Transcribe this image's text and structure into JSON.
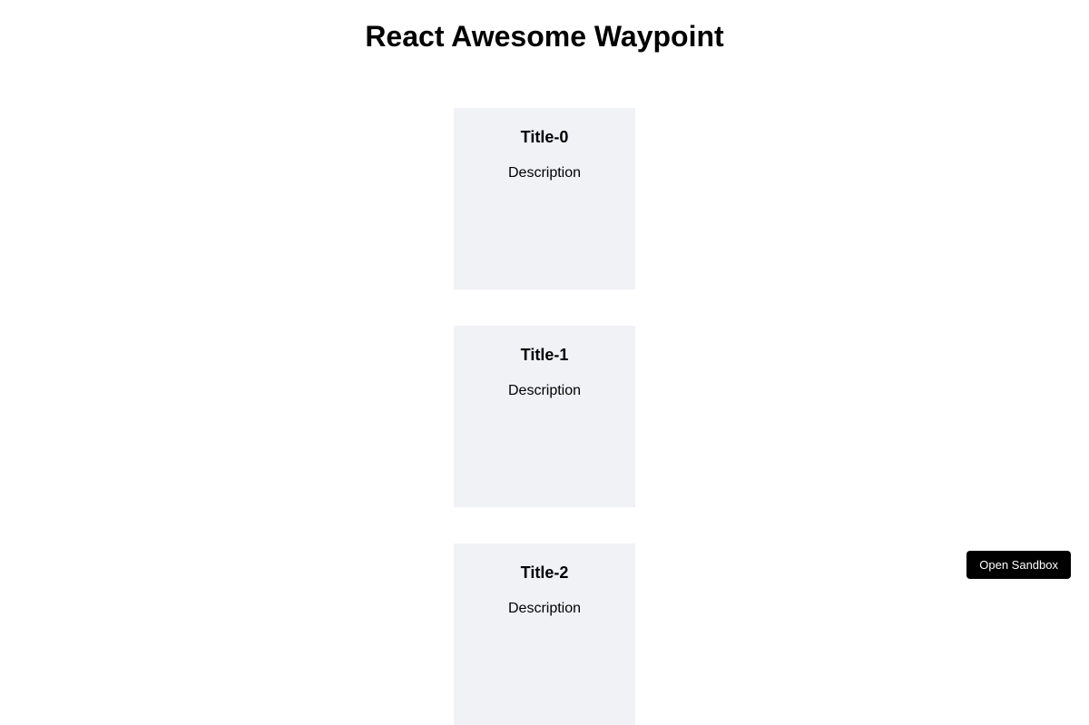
{
  "header": {
    "title": "React Awesome Waypoint"
  },
  "cards": [
    {
      "title": "Title-0",
      "description": "Description"
    },
    {
      "title": "Title-1",
      "description": "Description"
    },
    {
      "title": "Title-2",
      "description": "Description"
    }
  ],
  "footer": {
    "open_sandbox_label": "Open Sandbox"
  }
}
